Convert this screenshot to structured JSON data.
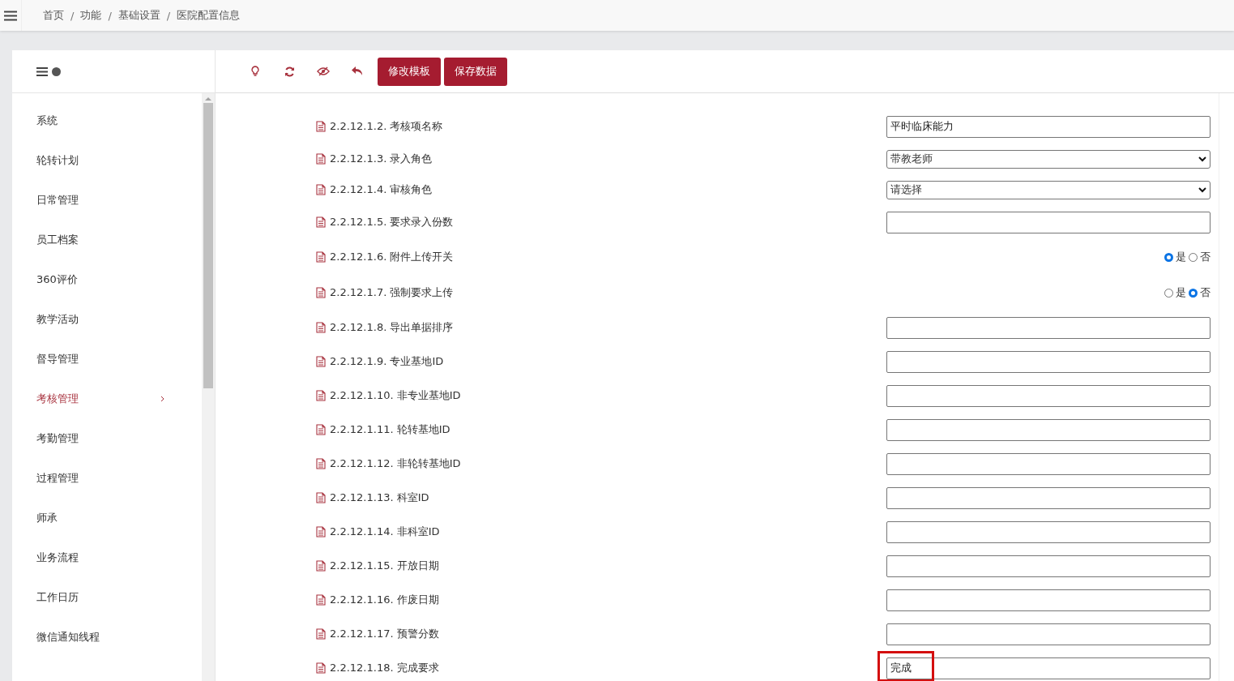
{
  "breadcrumb": [
    "首页",
    "功能",
    "基础设置",
    "医院配置信息"
  ],
  "breadcrumb_separator": "/",
  "sidebar": {
    "items": [
      {
        "label": "系统",
        "selected": false
      },
      {
        "label": "轮转计划",
        "selected": false
      },
      {
        "label": "日常管理",
        "selected": false
      },
      {
        "label": "员工档案",
        "selected": false
      },
      {
        "label": "360评价",
        "selected": false
      },
      {
        "label": "教学活动",
        "selected": false
      },
      {
        "label": "督导管理",
        "selected": false
      },
      {
        "label": "考核管理",
        "selected": true
      },
      {
        "label": "考勤管理",
        "selected": false
      },
      {
        "label": "过程管理",
        "selected": false
      },
      {
        "label": "师承",
        "selected": false
      },
      {
        "label": "业务流程",
        "selected": false
      },
      {
        "label": "工作日历",
        "selected": false
      },
      {
        "label": "微信通知线程",
        "selected": false
      }
    ]
  },
  "toolbar": {
    "buttons": [
      "修改模板",
      "保存数据"
    ]
  },
  "fields": [
    {
      "kind": "text",
      "label": "2.2.12.1.2. 考核项名称",
      "value": "平时临床能力"
    },
    {
      "kind": "select",
      "label": "2.2.12.1.3. 录入角色",
      "value": "带教老师"
    },
    {
      "kind": "select",
      "label": "2.2.12.1.4. 审核角色",
      "value": "请选择"
    },
    {
      "kind": "text",
      "label": "2.2.12.1.5. 要求录入份数"
    },
    {
      "kind": "radio",
      "label": "2.2.12.1.6. 附件上传开关",
      "options": [
        {
          "label": "是",
          "selected": true
        },
        {
          "label": "否",
          "selected": false
        }
      ]
    },
    {
      "kind": "radio",
      "label": "2.2.12.1.7. 强制要求上传",
      "options": [
        {
          "label": "是",
          "selected": false
        },
        {
          "label": "否",
          "selected": true
        }
      ]
    },
    {
      "kind": "text",
      "label": "2.2.12.1.8. 导出单据排序"
    },
    {
      "kind": "text",
      "label": "2.2.12.1.9. 专业基地ID"
    },
    {
      "kind": "text",
      "label": "2.2.12.1.10. 非专业基地ID"
    },
    {
      "kind": "text",
      "label": "2.2.12.1.11. 轮转基地ID"
    },
    {
      "kind": "text",
      "label": "2.2.12.1.12. 非轮转基地ID"
    },
    {
      "kind": "text",
      "label": "2.2.12.1.13. 科室ID"
    },
    {
      "kind": "text",
      "label": "2.2.12.1.14. 非科室ID"
    },
    {
      "kind": "text",
      "label": "2.2.12.1.15. 开放日期"
    },
    {
      "kind": "text",
      "label": "2.2.12.1.16. 作废日期"
    },
    {
      "kind": "text",
      "label": "2.2.12.1.17. 预警分数"
    },
    {
      "kind": "text",
      "label": "2.2.12.1.18. 完成要求",
      "value": "完成",
      "highlighted": true
    }
  ]
}
